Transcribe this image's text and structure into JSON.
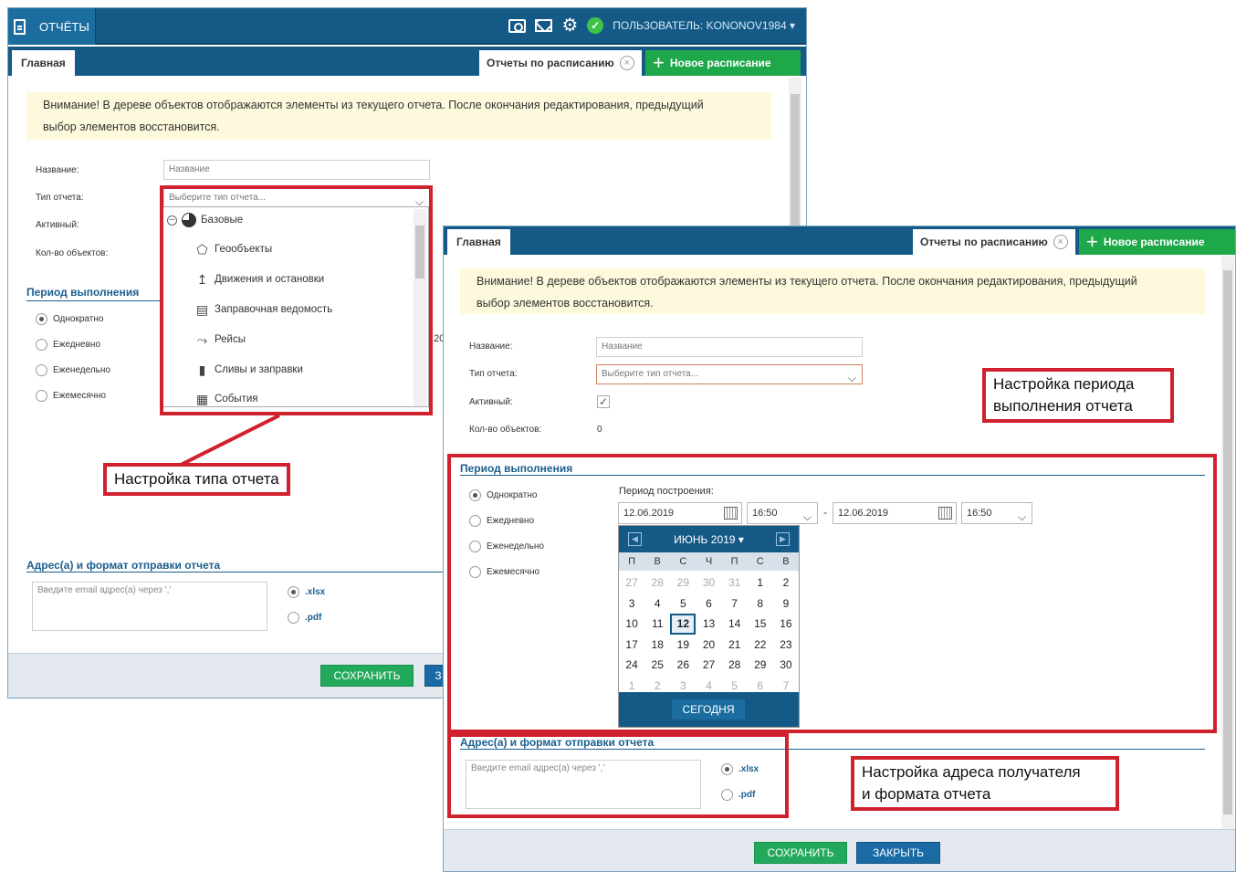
{
  "app": {
    "title": "ОТЧЁТЫ",
    "user": "ПОЛЬЗОВАТЕЛЬ: KONONOV1984",
    "user_caret": "▾"
  },
  "tabs": {
    "main": "Главная",
    "schedule": "Отчеты по расписанию",
    "new": "Новое расписание"
  },
  "notice": {
    "line1": "Внимание! В дереве объектов отображаются элементы из текущего отчета. После окончания редактирования, предыдущий",
    "line2": "выбор элементов восстановится."
  },
  "form": {
    "name_label": "Название:",
    "name_placeholder": "Название",
    "type_label": "Тип отчета:",
    "type_placeholder": "Выберите тип отчета...",
    "active_label": "Активный:",
    "count_label": "Кол-во объектов:",
    "count_value": "0"
  },
  "report_types": {
    "group": "Базовые",
    "items": [
      "Геообъекты",
      "Движения и остановки",
      "Заправочная ведомость",
      "Рейсы",
      "Сливы и заправки",
      "События"
    ]
  },
  "period": {
    "title": "Период выполнения",
    "build_label": "Период построения:",
    "options": [
      "Однократно",
      "Ежедневно",
      "Еженедельно",
      "Ежемесячно"
    ],
    "start_date": "12.06.2019",
    "start_time": "16:50",
    "separator": "-",
    "end_date": "12.06.2019",
    "end_time": "16:50",
    "partial_value": "20"
  },
  "calendar": {
    "month": "ИЮНЬ 2019",
    "caret": "▾",
    "dows": [
      "П",
      "В",
      "С",
      "Ч",
      "П",
      "С",
      "В"
    ],
    "days": [
      "27",
      "28",
      "29",
      "30",
      "31",
      "1",
      "2",
      "3",
      "4",
      "5",
      "6",
      "7",
      "8",
      "9",
      "10",
      "11",
      "12",
      "13",
      "14",
      "15",
      "16",
      "17",
      "18",
      "19",
      "20",
      "21",
      "22",
      "23",
      "24",
      "25",
      "26",
      "27",
      "28",
      "29",
      "30",
      "1",
      "2",
      "3",
      "4",
      "5",
      "6",
      "7"
    ],
    "today_label": "СЕГОДНЯ",
    "selected": "12"
  },
  "delivery": {
    "title": "Адрес(а) и формат отправки отчета",
    "email_placeholder": "Введите email адрес(а) через ','",
    "formats": [
      ".xlsx",
      ".pdf"
    ]
  },
  "buttons": {
    "save": "СОХРАНИТЬ",
    "close": "ЗАКРЫТЬ",
    "close_partial": "З"
  },
  "annotations": {
    "type": "Настройка типа отчета",
    "period_line1": "Настройка периода",
    "period_line2": "выполнения отчета",
    "address_line1": "Настройка адреса получателя",
    "address_line2": "и формата отчета"
  },
  "colors": {
    "header": "#155a86",
    "accent_green": "#23a95b",
    "annotation_red": "#d0212e",
    "notice_bg": "#fdf9dc"
  }
}
